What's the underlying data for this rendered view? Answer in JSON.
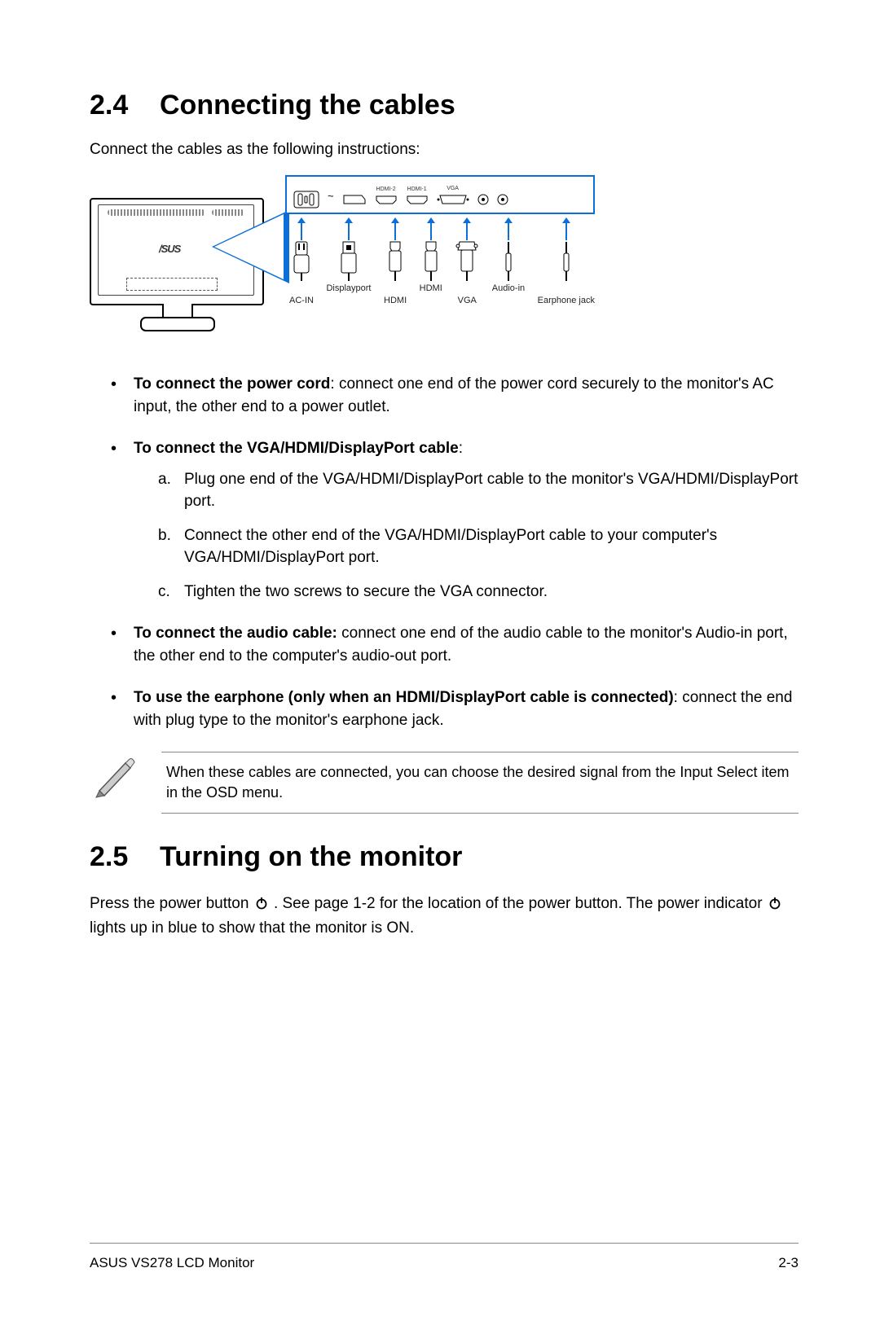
{
  "section24": {
    "num": "2.4",
    "title": "Connecting the cables",
    "intro": "Connect the cables as the following instructions:"
  },
  "diagram": {
    "monitor_brand": "/SUS",
    "port_labels": {
      "hdmi2": "HDMI-2",
      "hdmi1": "HDMI-1",
      "vga": "VGA"
    },
    "cable_labels": {
      "ac": "AC-IN",
      "dp": "Displayport",
      "hdmi_top": "HDMI",
      "hdmi_bottom": "HDMI",
      "vga": "VGA",
      "audio": "Audio-in",
      "earphone": "Earphone jack"
    }
  },
  "bullets": {
    "power_bold": "To connect the power cord",
    "power_rest": ": connect one end of the power cord securely to the monitor's AC input, the other end to a power outlet.",
    "video_bold": "To connect the VGA/HDMI/DisplayPort cable",
    "video_colon": ":",
    "video_sub": {
      "a_lbl": "a.",
      "a": "Plug one end of the VGA/HDMI/DisplayPort cable to the monitor's VGA/HDMI/DisplayPort port.",
      "b_lbl": "b.",
      "b": "Connect the other end of the VGA/HDMI/DisplayPort cable to your computer's VGA/HDMI/DisplayPort port.",
      "c_lbl": "c.",
      "c": "Tighten the two screws to secure the VGA connector."
    },
    "audio_bold": "To connect the audio cable:",
    "audio_rest": " connect one end of the audio cable to the monitor's Audio-in port, the other end to the computer's audio-out port.",
    "earphone_bold": "To use the earphone (only when an HDMI/DisplayPort cable is connected)",
    "earphone_rest": ": connect the end with plug type to the monitor's earphone jack."
  },
  "note": "When these cables are connected, you can choose the desired signal from the Input Select item in the OSD menu.",
  "section25": {
    "num": "2.5",
    "title": "Turning on the monitor",
    "text1": "Press the power button ",
    "text2": " . See page 1-2 for the location of the power button. The power indicator ",
    "text3": " lights up in blue to show that the monitor is ON."
  },
  "footer": {
    "left": "ASUS VS278 LCD Monitor",
    "right": "2-3"
  }
}
